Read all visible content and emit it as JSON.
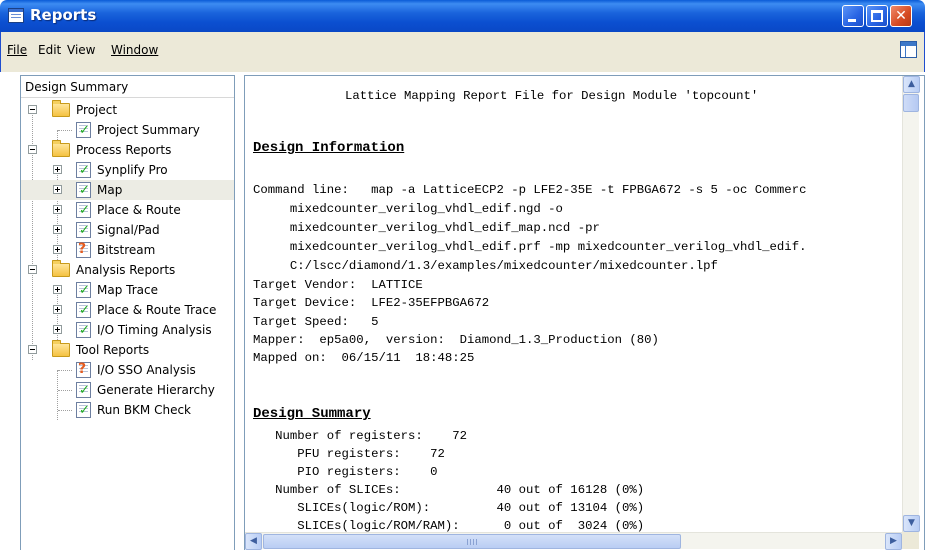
{
  "window": {
    "title": "Reports",
    "app_icon": "report-window-icon"
  },
  "menu": {
    "file": "File",
    "edit": "Edit",
    "view": "View",
    "window": "Window"
  },
  "tree": {
    "header": "Design Summary",
    "project": "Project",
    "project_summary": "Project Summary",
    "process_reports": "Process Reports",
    "synplify_pro": "Synplify Pro",
    "map": "Map",
    "place_route": "Place & Route",
    "signal_pad": "Signal/Pad",
    "bitstream": "Bitstream",
    "analysis_reports": "Analysis Reports",
    "map_trace": "Map Trace",
    "place_route_trace": "Place & Route Trace",
    "io_timing": "I/O Timing Analysis",
    "tool_reports": "Tool Reports",
    "io_sso": "I/O SSO Analysis",
    "generate_hierarchy": "Generate Hierarchy",
    "run_bkm": "Run BKM Check"
  },
  "report": {
    "title_line": "Lattice Mapping Report File for Design Module 'topcount'",
    "design_information": "Design Information",
    "cmd1": "Command line:   map -a LatticeECP2 -p LFE2-35E -t FPBGA672 -s 5 -oc Commerc",
    "cmd2": "     mixedcounter_verilog_vhdl_edif.ngd -o",
    "cmd3": "     mixedcounter_verilog_vhdl_edif_map.ncd -pr",
    "cmd4": "     mixedcounter_verilog_vhdl_edif.prf -mp mixedcounter_verilog_vhdl_edif.",
    "cmd5": "     C:/lscc/diamond/1.3/examples/mixedcounter/mixedcounter.lpf",
    "vendor": "Target Vendor:  LATTICE",
    "device": "Target Device:  LFE2-35EFPBGA672",
    "speed": "Target Speed:   5",
    "mapper": "Mapper:  ep5a00,  version:  Diamond_1.3_Production (80)",
    "mapped_on": "Mapped on:  06/15/11  18:48:25",
    "design_summary": "Design Summary",
    "s1": "   Number of registers:    72",
    "s2": "      PFU registers:    72",
    "s3": "      PIO registers:    0",
    "s4": "   Number of SLICEs:             40 out of 16128 (0%)",
    "s5": "      SLICEs(logic/ROM):         40 out of 13104 (0%)",
    "s6": "      SLICEs(logic/ROM/RAM):      0 out of  3024 (0%)"
  }
}
